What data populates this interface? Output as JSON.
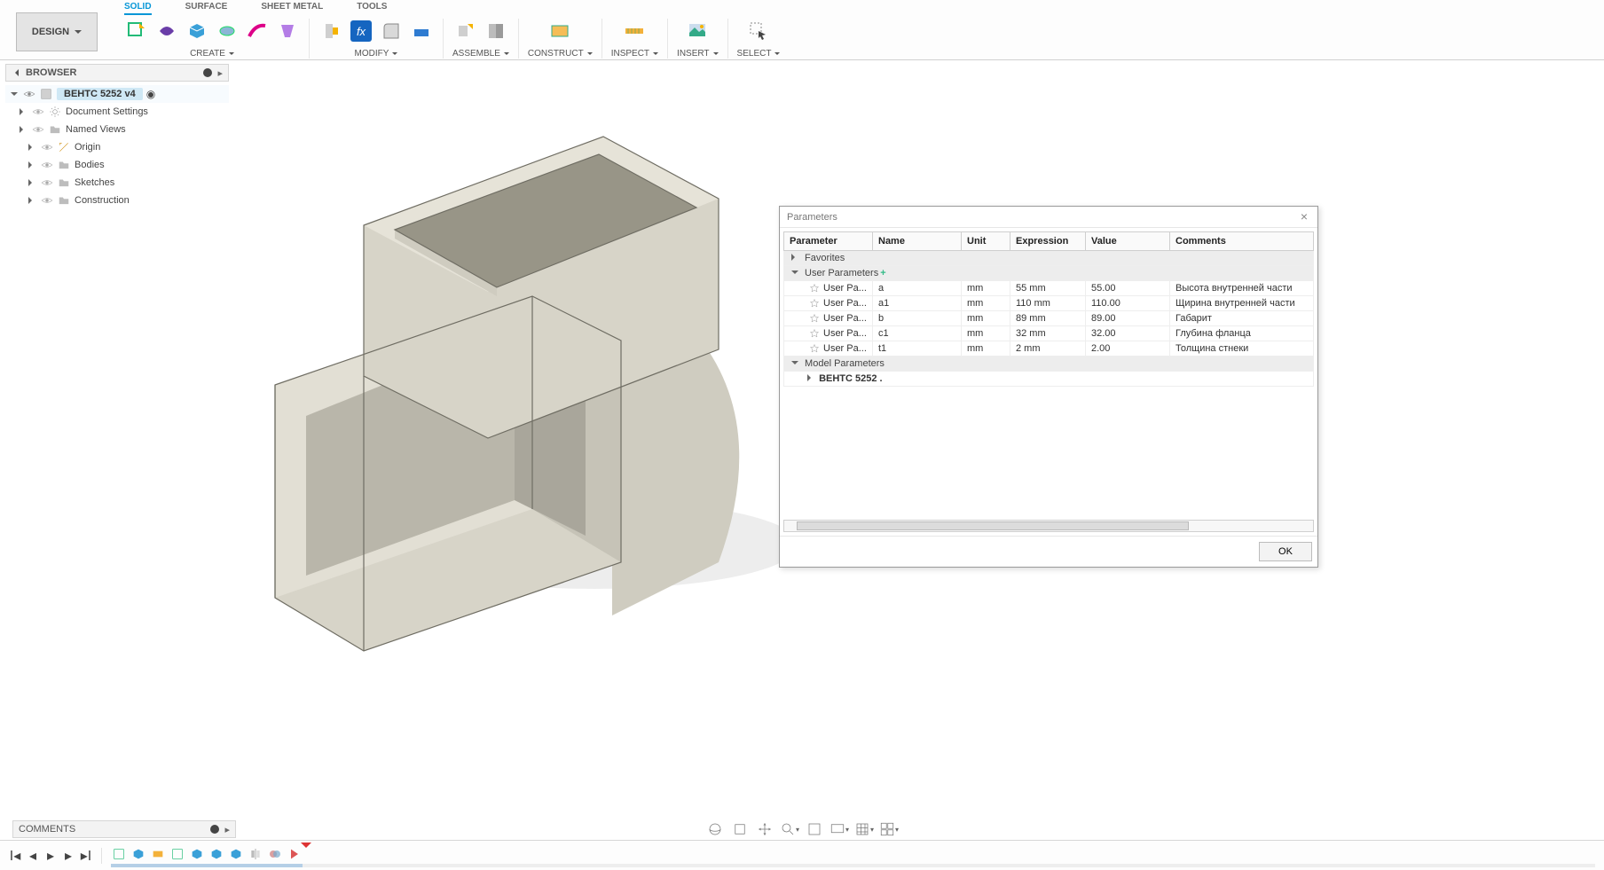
{
  "workspace": {
    "label": "DESIGN"
  },
  "tabs": [
    "SOLID",
    "SURFACE",
    "SHEET METAL",
    "TOOLS"
  ],
  "active_tab": "SOLID",
  "toolgroups": {
    "create": {
      "label": "CREATE"
    },
    "modify": {
      "label": "MODIFY"
    },
    "assemble": {
      "label": "ASSEMBLE"
    },
    "construct": {
      "label": "CONSTRUCT"
    },
    "inspect": {
      "label": "INSPECT"
    },
    "insert": {
      "label": "INSERT"
    },
    "select": {
      "label": "SELECT"
    }
  },
  "browser": {
    "title": "BROWSER",
    "root": "ВЕНТС 5252 v4",
    "nodes": [
      {
        "label": "Document Settings",
        "icon": "gear"
      },
      {
        "label": "Named Views",
        "icon": "folder"
      },
      {
        "label": "Origin",
        "icon": "origin",
        "indent": true
      },
      {
        "label": "Bodies",
        "icon": "folder",
        "indent": true
      },
      {
        "label": "Sketches",
        "icon": "folder",
        "indent": true
      },
      {
        "label": "Construction",
        "icon": "folder",
        "indent": true
      }
    ]
  },
  "dialog": {
    "title": "Parameters",
    "columns": [
      "Parameter",
      "Name",
      "Unit",
      "Expression",
      "Value",
      "Comments"
    ],
    "groups": {
      "favorites": "Favorites",
      "user": "User Parameters",
      "model": "Model Parameters"
    },
    "user_params": [
      {
        "p": "User Pa...",
        "name": "a",
        "unit": "mm",
        "expr": "55 mm",
        "value": "55.00",
        "comment": "Высота внутренней части"
      },
      {
        "p": "User Pa...",
        "name": "a1",
        "unit": "mm",
        "expr": "110 mm",
        "value": "110.00",
        "comment": "Щирина внутренней части"
      },
      {
        "p": "User Pa...",
        "name": "b",
        "unit": "mm",
        "expr": "89 mm",
        "value": "89.00",
        "comment": "Габарит"
      },
      {
        "p": "User Pa...",
        "name": "c1",
        "unit": "mm",
        "expr": "32 mm",
        "value": "32.00",
        "comment": "Глубина фланца"
      },
      {
        "p": "User Pa...",
        "name": "t1",
        "unit": "mm",
        "expr": "2 mm",
        "value": "2.00",
        "comment": "Толщина стнеки"
      }
    ],
    "model_sub": "ВЕНТС 5252 .",
    "ok": "OK"
  },
  "comments": {
    "title": "COMMENTS"
  }
}
